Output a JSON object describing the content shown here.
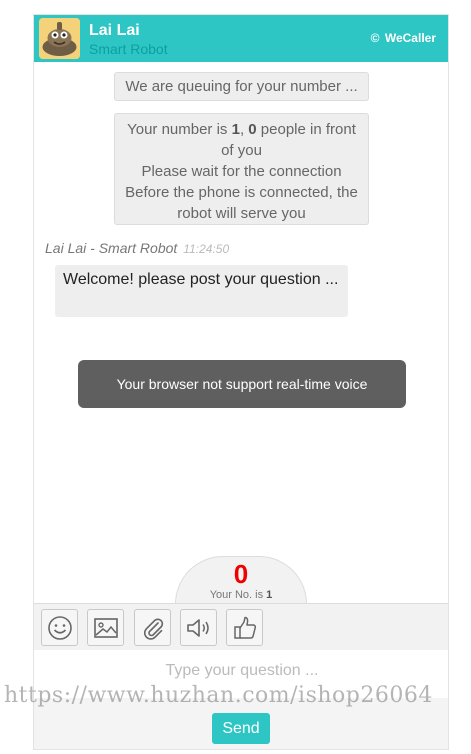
{
  "header": {
    "name": "Lai Lai",
    "subtitle": "Smart Robot",
    "brand": "WeCaller",
    "brand_symbol": "©",
    "accent_color": "#2ec6c4"
  },
  "chat": {
    "system_messages": [
      {
        "text": "We are queuing for your number ..."
      },
      {
        "line1_prefix": "Your number is ",
        "queue_number": "1",
        "line1_sep": ", ",
        "people_ahead": "0",
        "line1_suffix": " people in front of you",
        "line2": "Please wait for the connection",
        "line3": "Before the phone is connected, the robot will serve you"
      }
    ],
    "message": {
      "sender": "Lai Lai - Smart Robot",
      "time": "11:24:50",
      "text": "Welcome! please post your question ..."
    },
    "toast": "Your browser not support real-time voice"
  },
  "queue": {
    "count": "0",
    "label_prefix": "Your No. is ",
    "number": "1",
    "count_color": "#f10000"
  },
  "toolbar": {
    "icons": [
      "smiley-icon",
      "image-icon",
      "attachment-icon",
      "speaker-icon",
      "thumbs-up-icon"
    ]
  },
  "input": {
    "placeholder": "Type your question ...",
    "value": ""
  },
  "send_label": "Send",
  "watermark": "https://www.huzhan.com/ishop26064"
}
